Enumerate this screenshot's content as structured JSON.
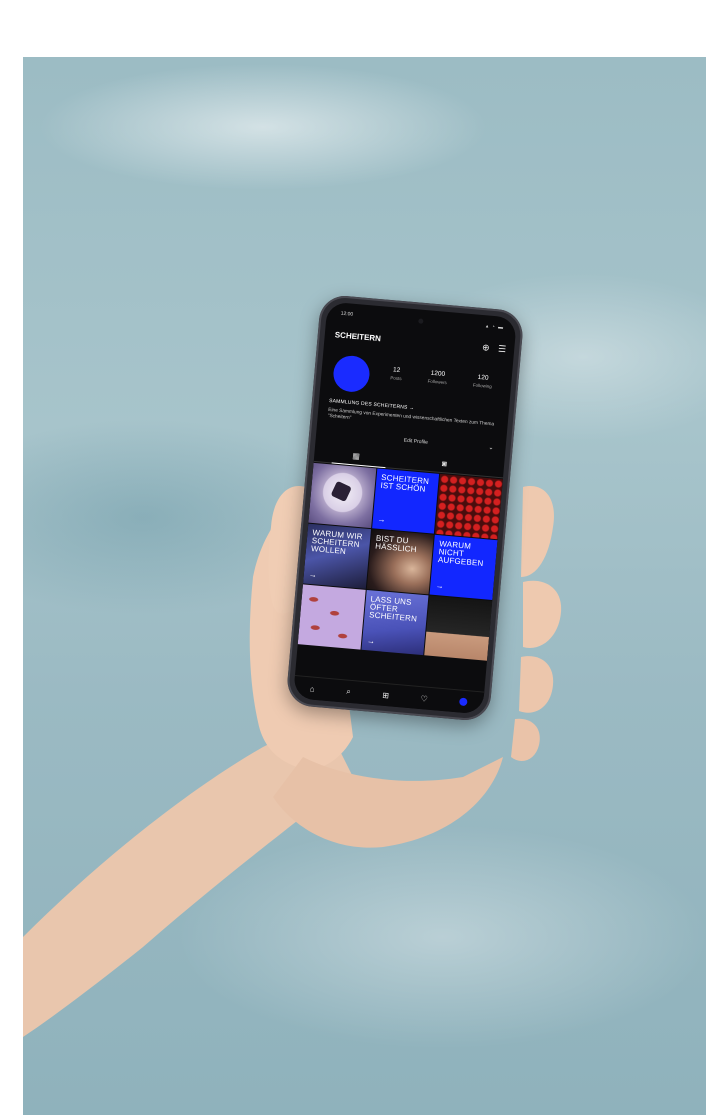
{
  "status": {
    "time": "12:00",
    "icons": "▴ ◔ ▬"
  },
  "profile": {
    "username": "SCHEITERN",
    "stats": [
      {
        "value": "12",
        "label": "Posts"
      },
      {
        "value": "1200",
        "label": "Followers"
      },
      {
        "value": "120",
        "label": "Following"
      }
    ],
    "collection": "SAMMLUNG DES SCHEITERNS →",
    "bio": "Eine Sammlung von Experimenten und wissenschaftlichen Texten zum Thema \"Scheitern\"",
    "edit_label": "Edit Profile"
  },
  "grid": {
    "posts": [
      {
        "text": ""
      },
      {
        "text": "SCHEITERN IST SCHÖN",
        "arrow": "→"
      },
      {
        "text": ""
      },
      {
        "text": "WARUM WIR SCHEITERN WOLLEN",
        "arrow": "→"
      },
      {
        "text": "BIST DU HÄSSLICH",
        "arrow": ""
      },
      {
        "text": "WARUM NICHT AUFGEBEN",
        "arrow": "→"
      },
      {
        "text": ""
      },
      {
        "text": "LASS UNS ÖFTER SCHEITERN",
        "arrow": "→"
      },
      {
        "text": ""
      }
    ]
  },
  "colors": {
    "accent": "#1227ff",
    "sky": "#9cbcc4"
  },
  "icons": {
    "add": "add-icon",
    "menu": "menu-icon",
    "grid": "grid-icon",
    "tagged": "tagged-icon",
    "home": "home-icon",
    "search": "search-icon",
    "create": "create-icon",
    "heart": "heart-icon"
  }
}
